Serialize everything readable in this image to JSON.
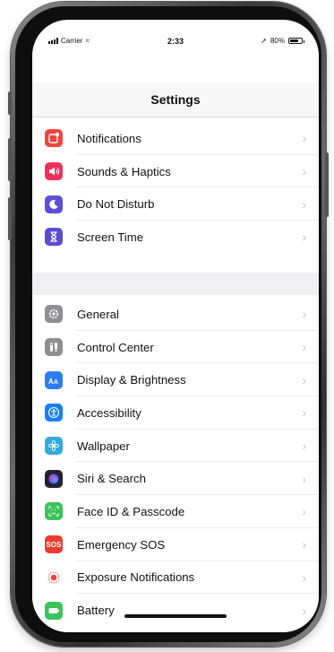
{
  "status_bar": {
    "carrier": "Carrier",
    "time": "2:33",
    "battery": "80%",
    "battery_level": 0.8
  },
  "nav": {
    "title": "Settings"
  },
  "groups": [
    {
      "items": [
        {
          "label": "Notifications",
          "icon": "notifications-icon",
          "color": "#f1453d"
        },
        {
          "label": "Sounds & Haptics",
          "icon": "speaker-icon",
          "color": "#f0305c"
        },
        {
          "label": "Do Not Disturb",
          "icon": "moon-icon",
          "color": "#5e4fd6"
        },
        {
          "label": "Screen Time",
          "icon": "hourglass-icon",
          "color": "#5a4bd1"
        }
      ]
    },
    {
      "items": [
        {
          "label": "General",
          "icon": "gear-icon",
          "color": "#8e8e93"
        },
        {
          "label": "Control Center",
          "icon": "toggles-icon",
          "color": "#8e8e93"
        },
        {
          "label": "Display & Brightness",
          "icon": "text-size-icon",
          "color": "#2e7cf6"
        },
        {
          "label": "Accessibility",
          "icon": "accessibility-icon",
          "color": "#1a7ff2"
        },
        {
          "label": "Wallpaper",
          "icon": "flower-icon",
          "color": "#35aadc"
        },
        {
          "label": "Siri & Search",
          "icon": "siri-icon",
          "color": "#222233"
        },
        {
          "label": "Face ID & Passcode",
          "icon": "face-id-icon",
          "color": "#3cc35b"
        },
        {
          "label": "Emergency SOS",
          "icon": "sos-icon",
          "color": "#ea3a30",
          "text": "SOS"
        },
        {
          "label": "Exposure Notifications",
          "icon": "exposure-icon",
          "color": "#ffffff"
        },
        {
          "label": "Battery",
          "icon": "battery-icon",
          "color": "#3cc35b"
        }
      ]
    }
  ]
}
